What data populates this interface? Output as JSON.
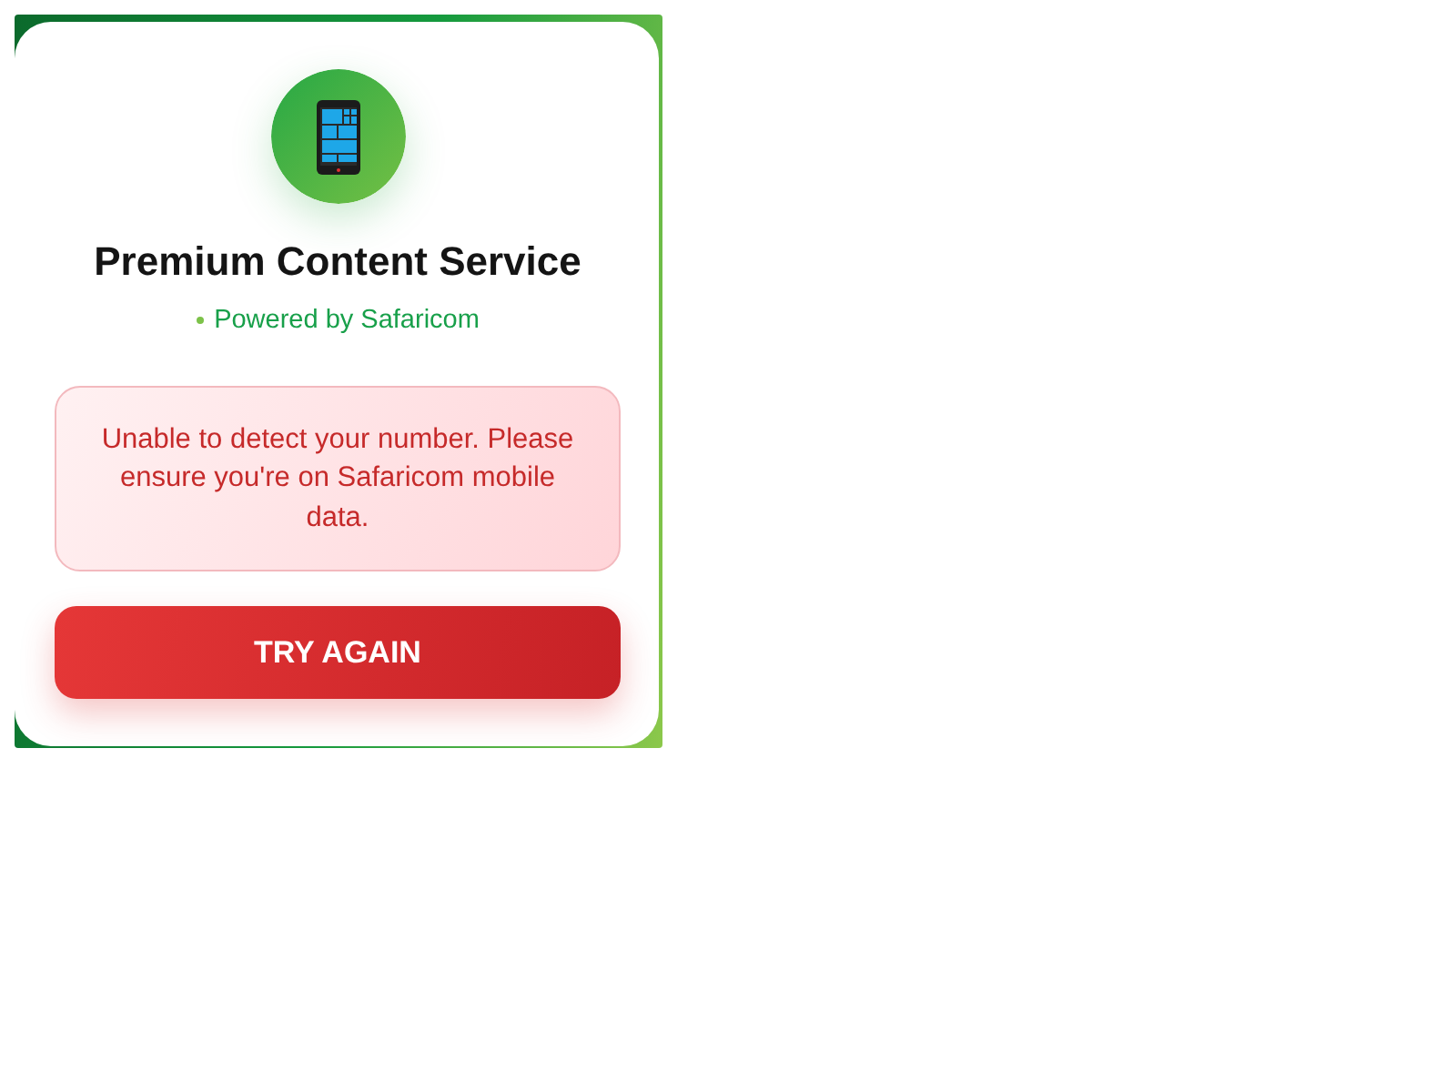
{
  "card": {
    "title": "Premium Content Service",
    "subtitle": "Powered by Safaricom"
  },
  "error": {
    "message": "Unable to detect your number. Please ensure you're on Safaricom mobile data."
  },
  "button": {
    "label": "TRY AGAIN"
  }
}
